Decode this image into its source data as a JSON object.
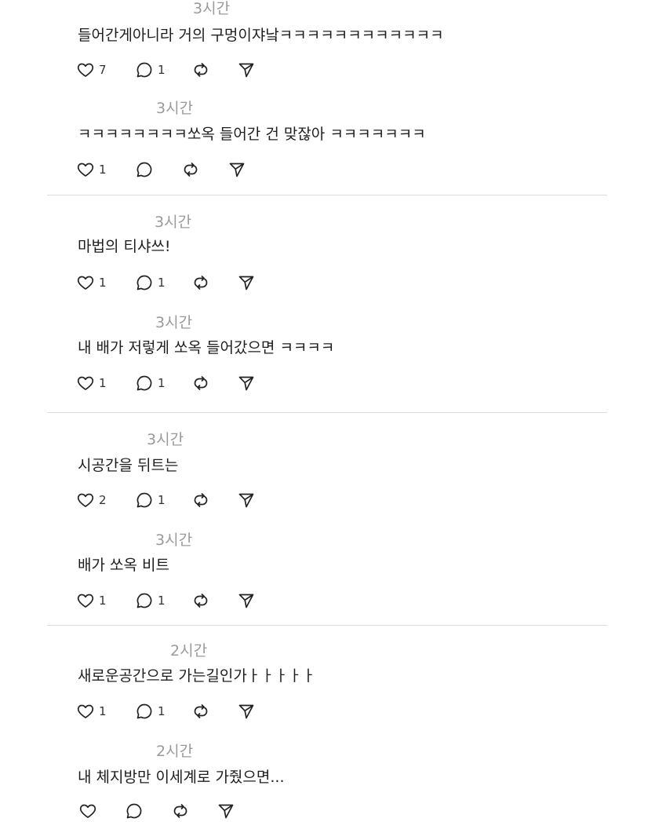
{
  "posts": [
    {
      "time": "3시간",
      "text": "들어간게아니라 거의 구멍이쟈낰ㅋㅋㅋㅋㅋㅋㅋㅋㅋㅋㅋㅋ",
      "likes": "7",
      "replies": "1"
    },
    {
      "time": "3시간",
      "text": "ㅋㅋㅋㅋㅋㅋㅋㅋ쏘옥 들어간 건 맞잖아 ㅋㅋㅋㅋㅋㅋㅋ",
      "likes": "1",
      "replies": ""
    },
    {
      "time": "3시간",
      "text": "마법의 티샤쓰!",
      "likes": "1",
      "replies": "1"
    },
    {
      "time": "3시간",
      "text": "내 배가 저렇게 쏘옥 들어갔으면 ㅋㅋㅋㅋ",
      "likes": "1",
      "replies": "1"
    },
    {
      "time": "3시간",
      "text": "시공간을 뒤트는",
      "likes": "2",
      "replies": "1"
    },
    {
      "time": "3시간",
      "text": "배가 쏘옥 비트",
      "likes": "1",
      "replies": "1"
    },
    {
      "time": "2시간",
      "text": "새로운공간으로 가는길인가ㅏㅏㅏㅏㅏ",
      "likes": "1",
      "replies": "1"
    },
    {
      "time": "2시간",
      "text": "내 체지방만 이세계로 가줬으면...",
      "likes": "",
      "replies": ""
    }
  ],
  "icons": {
    "like": "heart-icon",
    "reply": "speech-bubble-icon",
    "repost": "repost-icon",
    "share": "send-icon"
  }
}
